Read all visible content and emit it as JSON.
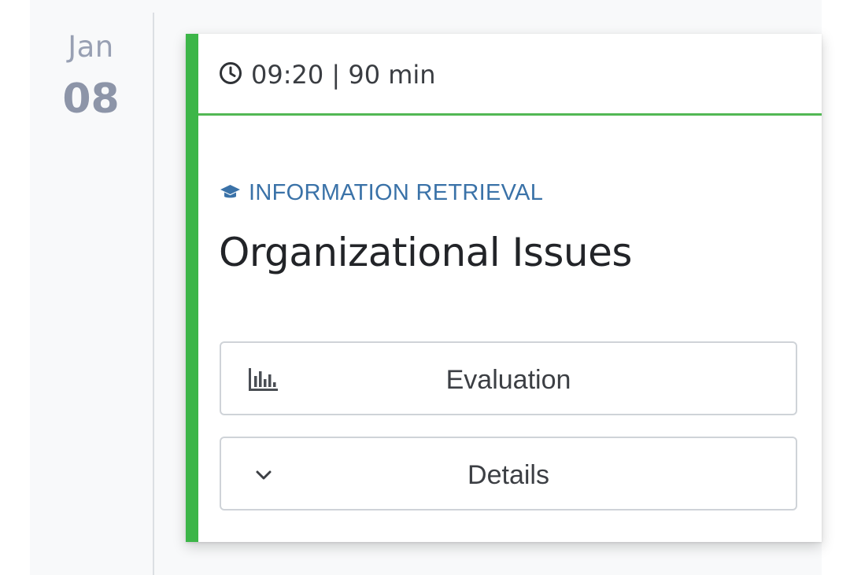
{
  "date": {
    "month": "Jan",
    "day": "08"
  },
  "event": {
    "time": "09:20 | 90 min",
    "time_icon": "clock-icon",
    "category": "INFORMATION RETRIEVAL",
    "category_icon": "graduation-cap-icon",
    "title": "Organizational Issues",
    "accent_color": "#3cb648",
    "category_color": "#3a72a8"
  },
  "actions": {
    "evaluation_label": "Evaluation",
    "evaluation_icon": "bar-chart-icon",
    "details_label": "Details",
    "details_icon": "chevron-down-icon"
  }
}
